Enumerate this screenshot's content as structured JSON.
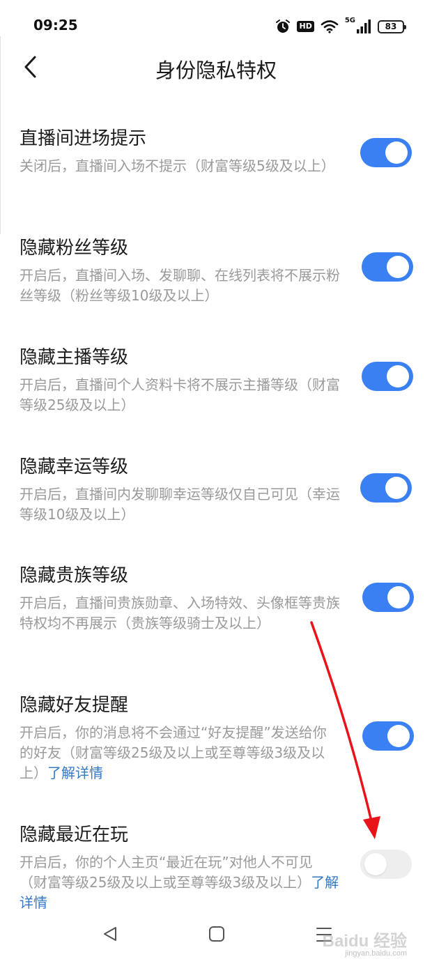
{
  "status_bar": {
    "time": "09:25",
    "hd_label": "HD",
    "network_label": "5G",
    "battery_level": "83",
    "icons": [
      "alarm-icon",
      "hd-icon",
      "wifi-icon",
      "signal-icon",
      "battery-icon"
    ]
  },
  "header": {
    "back_icon": "chevron-left-icon",
    "title": "身份隐私特权"
  },
  "settings": [
    {
      "title": "直播间进场提示",
      "description": "关闭后，直播间入场不提示（财富等级5级及以上）",
      "enabled": true
    },
    {
      "title": "隐藏粉丝等级",
      "description": "开启后，直播间入场、发聊聊、在线列表将不展示粉丝等级（粉丝等级10级及以上）",
      "enabled": true
    },
    {
      "title": "隐藏主播等级",
      "description": "开启后，直播间个人资料卡将不展示主播等级（财富等级25级及以上）",
      "enabled": true
    },
    {
      "title": "隐藏幸运等级",
      "description": "开启后，直播间内发聊聊幸运等级仅自己可见（幸运等级10级及以上）",
      "enabled": true
    },
    {
      "title": "隐藏贵族等级",
      "description": "开启后，直播间贵族勋章、入场特效、头像框等贵族特权均不再展示（贵族等级骑士及以上）",
      "enabled": true
    },
    {
      "title": "隐藏好友提醒",
      "description": "开启后，你的消息将不会通过“好友提醒”发送给你的好友（财富等级25级及以上或至尊等级3级及以上）",
      "link": "了解详情",
      "enabled": true
    },
    {
      "title": "隐藏最近在玩",
      "description": "开启后，你的个人主页“最近在玩”对他人不可见（财富等级25级及以上或至尊等级3级及以上）",
      "link": "了解详情",
      "enabled": false
    }
  ],
  "nav_bar": {
    "icons": [
      "back-triangle-icon",
      "home-square-icon",
      "menu-lines-icon"
    ]
  },
  "watermark": {
    "text": "Baidu 经验",
    "url": "jingyan.baidu.com"
  },
  "colors": {
    "toggle_on": "#3a80f2",
    "toggle_off": "#eeeeee",
    "link": "#3478c6",
    "description": "#9a9a9a",
    "annotation_arrow": "#e8141a"
  }
}
